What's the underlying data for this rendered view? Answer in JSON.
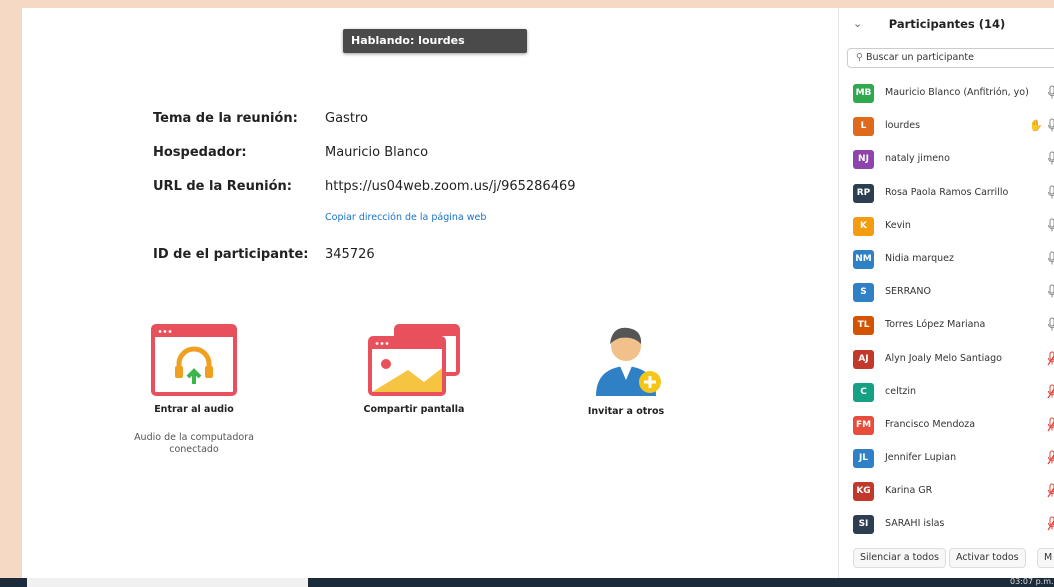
{
  "banner": {
    "speaking": "Hablando: lourdes"
  },
  "meeting": {
    "topic_label": "Tema de la reunión:",
    "topic_value": "Gastro",
    "host_label": "Hospedador:",
    "host_value": "Mauricio Blanco",
    "url_label": "URL de la Reunión:",
    "url_value": "https://us04web.zoom.us/j/965286469",
    "copy_link": "Copiar dirección de la página web",
    "pid_label": "ID de el participante:",
    "pid_value": "345726"
  },
  "actions": {
    "audio_label": "Entrar al audio",
    "audio_sub": "Audio de la computadora conectado",
    "share_label": "Compartir pantalla",
    "invite_label": "Invitar a otros"
  },
  "panel": {
    "title": "Participantes (14)",
    "collapse_icon": "chevron-down-icon",
    "search_placeholder": "Buscar un participante",
    "participants": [
      {
        "initials": "MB",
        "name": "Mauricio Blanco (Anfitrión, yo)",
        "color": "#2fa84f",
        "muted": false
      },
      {
        "initials": "L",
        "name": "lourdes",
        "color": "#e06a1b",
        "muted": false,
        "hand": true
      },
      {
        "initials": "NJ",
        "name": "nataly jimeno",
        "color": "#8e44ad",
        "muted": false
      },
      {
        "initials": "RP",
        "name": "Rosa Paola Ramos Carrillo",
        "color": "#2c3e50",
        "muted": false
      },
      {
        "initials": "K",
        "name": "Kevin",
        "color": "#f39c12",
        "muted": false
      },
      {
        "initials": "NM",
        "name": "Nidia marquez",
        "color": "#2f80c5",
        "muted": false
      },
      {
        "initials": "S",
        "name": "SERRANO",
        "color": "#2f80c5",
        "muted": false
      },
      {
        "initials": "TL",
        "name": "Torres López Mariana",
        "color": "#d35400",
        "muted": false
      },
      {
        "initials": "AJ",
        "name": "Alyn Joaly Melo Santiago",
        "color": "#c0392b",
        "muted": true
      },
      {
        "initials": "C",
        "name": "celtzin",
        "color": "#16a085",
        "muted": true
      },
      {
        "initials": "FM",
        "name": "Francisco Mendoza",
        "color": "#e74c3c",
        "muted": true
      },
      {
        "initials": "JL",
        "name": "Jennifer Lupian",
        "color": "#2f80c5",
        "muted": true
      },
      {
        "initials": "KG",
        "name": "Karina GR",
        "color": "#c0392b",
        "muted": true
      },
      {
        "initials": "SI",
        "name": "SARAHI islas",
        "color": "#2c3e50",
        "muted": true
      }
    ],
    "mute_all": "Silenciar a todos",
    "unmute_all": "Activar todos",
    "more": "M"
  },
  "taskbar": {
    "clock": "03:07 p.m."
  }
}
